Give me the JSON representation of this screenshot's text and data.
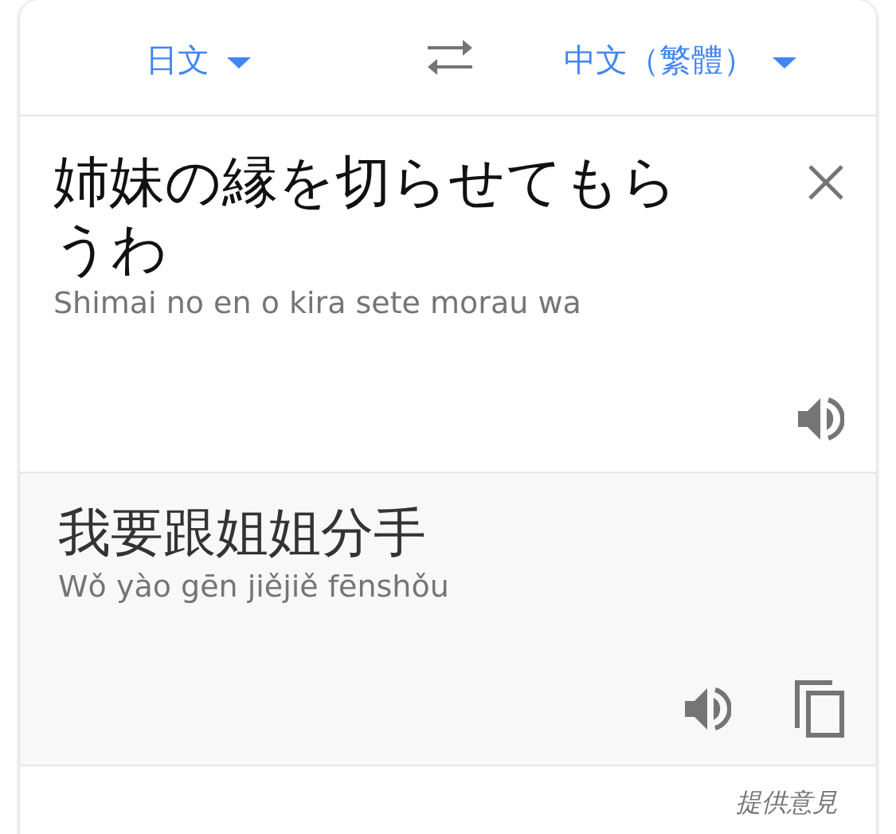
{
  "header": {
    "source_language": "日文",
    "target_language": "中文（繁體）"
  },
  "input": {
    "text": "姉妹の縁を切らせてもらうわ",
    "romanization": "Shimai no en o kira sete morau wa"
  },
  "output": {
    "text": "我要跟姐姐分手",
    "romanization": "Wǒ yào gēn jiějiě fēnshǒu"
  },
  "footer": {
    "link": "提供意見"
  }
}
